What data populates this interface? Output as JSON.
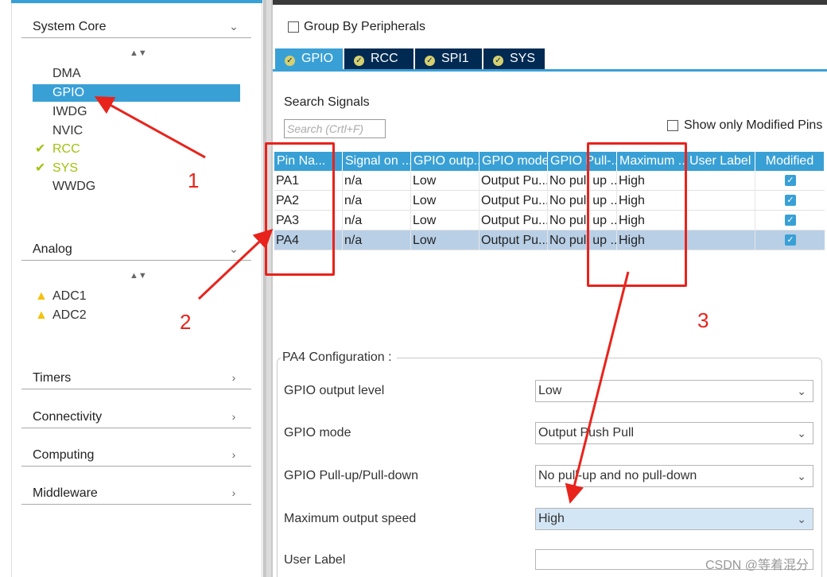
{
  "sidebar": {
    "categories": [
      {
        "label": "System Core",
        "chev": "⌄"
      },
      {
        "label": "Analog",
        "chev": "⌄"
      },
      {
        "label": "Timers",
        "chev": "›"
      },
      {
        "label": "Connectivity",
        "chev": "›"
      },
      {
        "label": "Computing",
        "chev": "›"
      },
      {
        "label": "Middleware",
        "chev": "›"
      }
    ],
    "system_core_items": [
      {
        "label": "DMA"
      },
      {
        "label": "GPIO"
      },
      {
        "label": "IWDG"
      },
      {
        "label": "NVIC"
      },
      {
        "label": "RCC"
      },
      {
        "label": "SYS"
      },
      {
        "label": "WWDG"
      }
    ],
    "analog_items": [
      {
        "label": "ADC1"
      },
      {
        "label": "ADC2"
      }
    ],
    "sort_glyph": "▲▼"
  },
  "main": {
    "group_by_label": "Group By Peripherals",
    "tabs": [
      {
        "label": "GPIO"
      },
      {
        "label": "RCC"
      },
      {
        "label": "SPI1"
      },
      {
        "label": "SYS"
      }
    ],
    "search_label": "Search Signals",
    "search_placeholder": "Search (Crtl+F)",
    "show_modified_label": "Show only Modified Pins",
    "table": {
      "headers": [
        "Pin Na...",
        "Signal on ...",
        "GPIO outp...",
        "GPIO mode",
        "GPIO Pull-...",
        "Maximum ...",
        "User Label",
        "Modified"
      ],
      "rows": [
        [
          "PA1",
          "n/a",
          "Low",
          "Output Pu...",
          "No pull up ...",
          "High",
          ""
        ],
        [
          "PA2",
          "n/a",
          "Low",
          "Output Pu...",
          "No pull up ...",
          "High",
          ""
        ],
        [
          "PA3",
          "n/a",
          "Low",
          "Output Pu...",
          "No pull up ...",
          "High",
          ""
        ],
        [
          "PA4",
          "n/a",
          "Low",
          "Output Pu...",
          "No pull up ...",
          "High",
          ""
        ]
      ]
    },
    "config": {
      "title": "PA4 Configuration :",
      "fields": [
        {
          "label": "GPIO output level",
          "value": "Low"
        },
        {
          "label": "GPIO mode",
          "value": "Output Push Pull"
        },
        {
          "label": "GPIO Pull-up/Pull-down",
          "value": "No pull-up and no pull-down"
        },
        {
          "label": "Maximum output speed",
          "value": "High"
        },
        {
          "label": "User Label",
          "value": ""
        }
      ]
    }
  },
  "annotations": [
    "1",
    "2",
    "3"
  ],
  "watermark": "CSDN @等着混分",
  "colors": {
    "accent": "#39a0d6",
    "tab_dark": "#002a52",
    "annotation_red": "#e8231c",
    "ok_green": "#a1c20f",
    "warn_yellow": "#f4c20d"
  }
}
